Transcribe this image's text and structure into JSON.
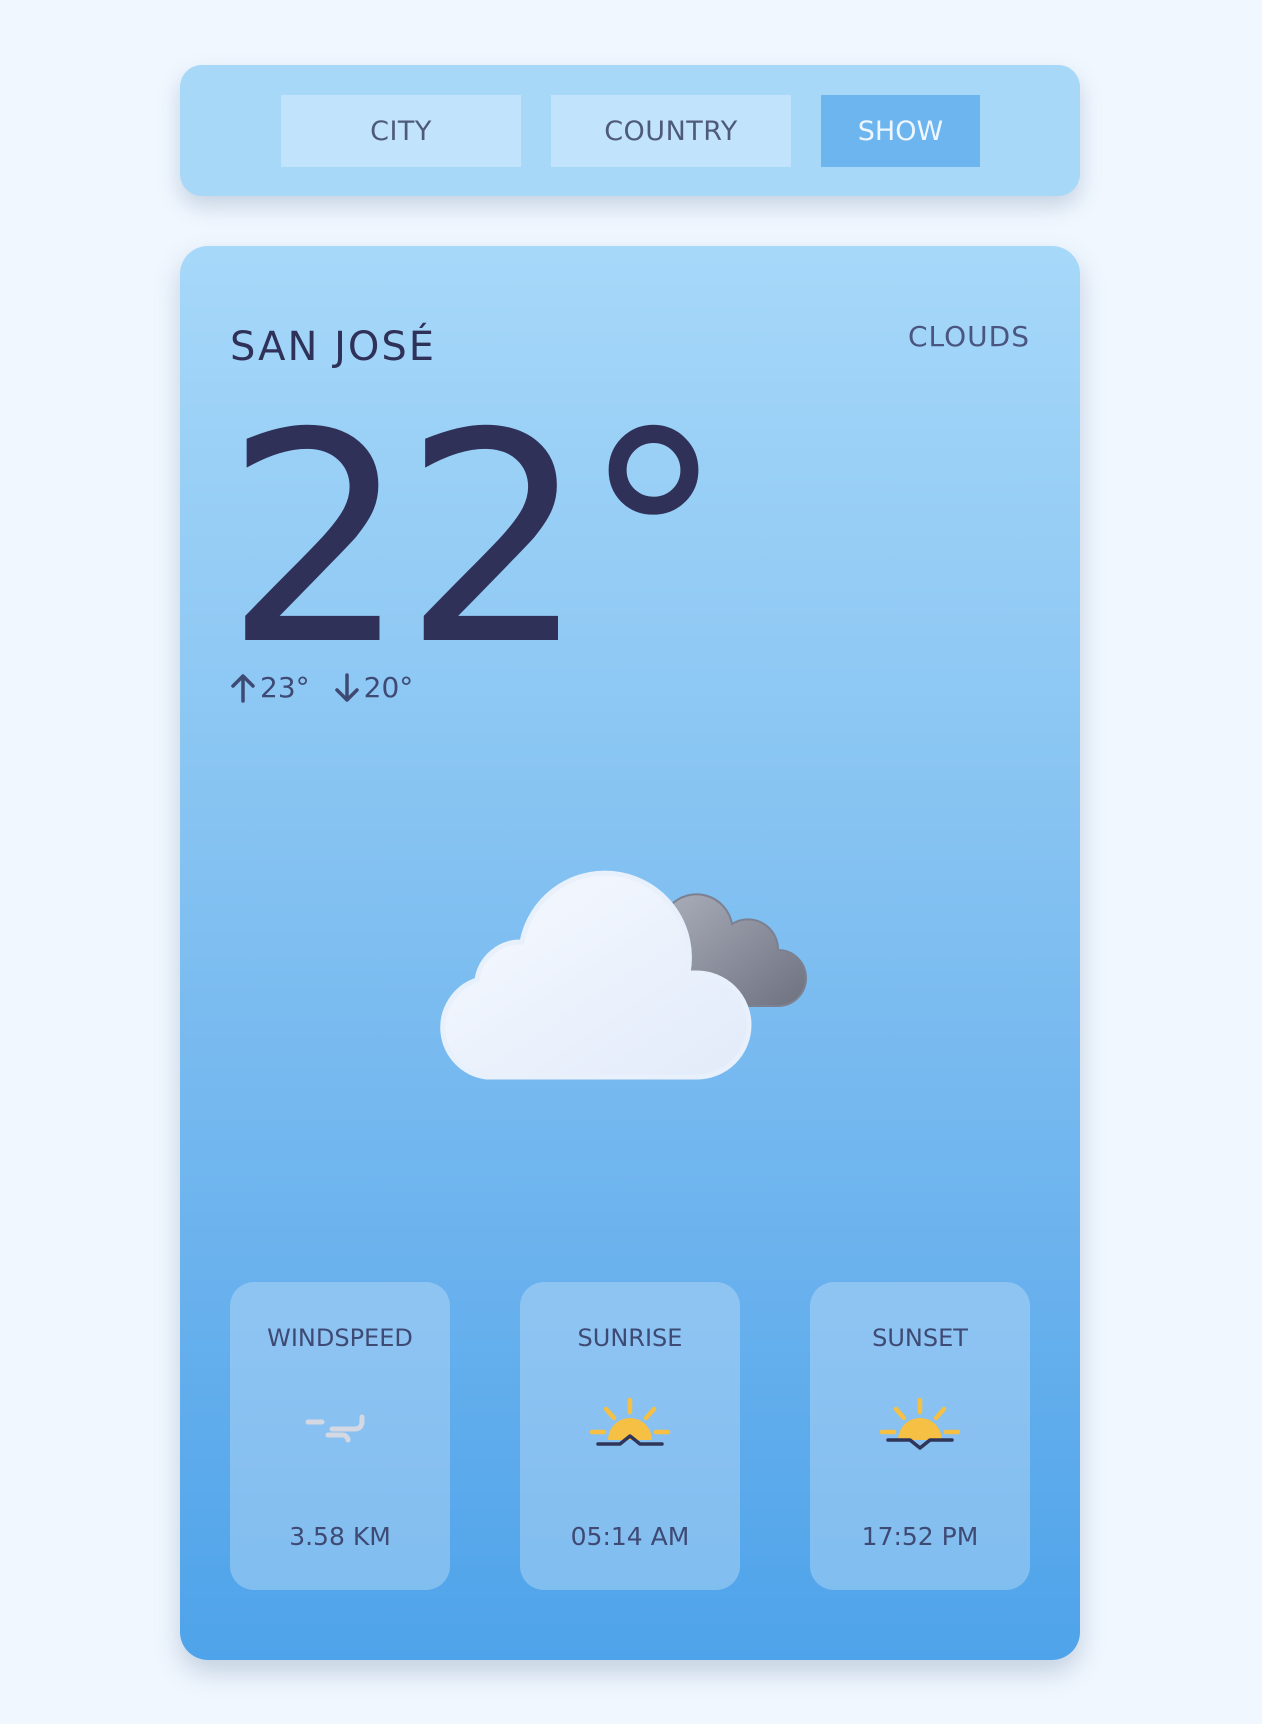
{
  "search": {
    "city_placeholder": "CITY",
    "country_placeholder": "COUNTRY",
    "show_label": "SHOW"
  },
  "weather": {
    "city": "SAN JOSÉ",
    "condition": "CLOUDS",
    "temperature": "22°",
    "max_temp": "23°",
    "min_temp": "20°",
    "condition_icon": "cloud-icon"
  },
  "details": [
    {
      "title": "WINDSPEED",
      "value": "3.58 KM",
      "icon": "wind-icon"
    },
    {
      "title": "SUNRISE",
      "value": "05:14 AM",
      "icon": "sunrise-icon"
    },
    {
      "title": "SUNSET",
      "value": "17:52 PM",
      "icon": "sunset-icon"
    }
  ],
  "colors": {
    "accent": "#6cb5ee",
    "text_dark": "#2f3158",
    "sun": "#f5c044"
  }
}
